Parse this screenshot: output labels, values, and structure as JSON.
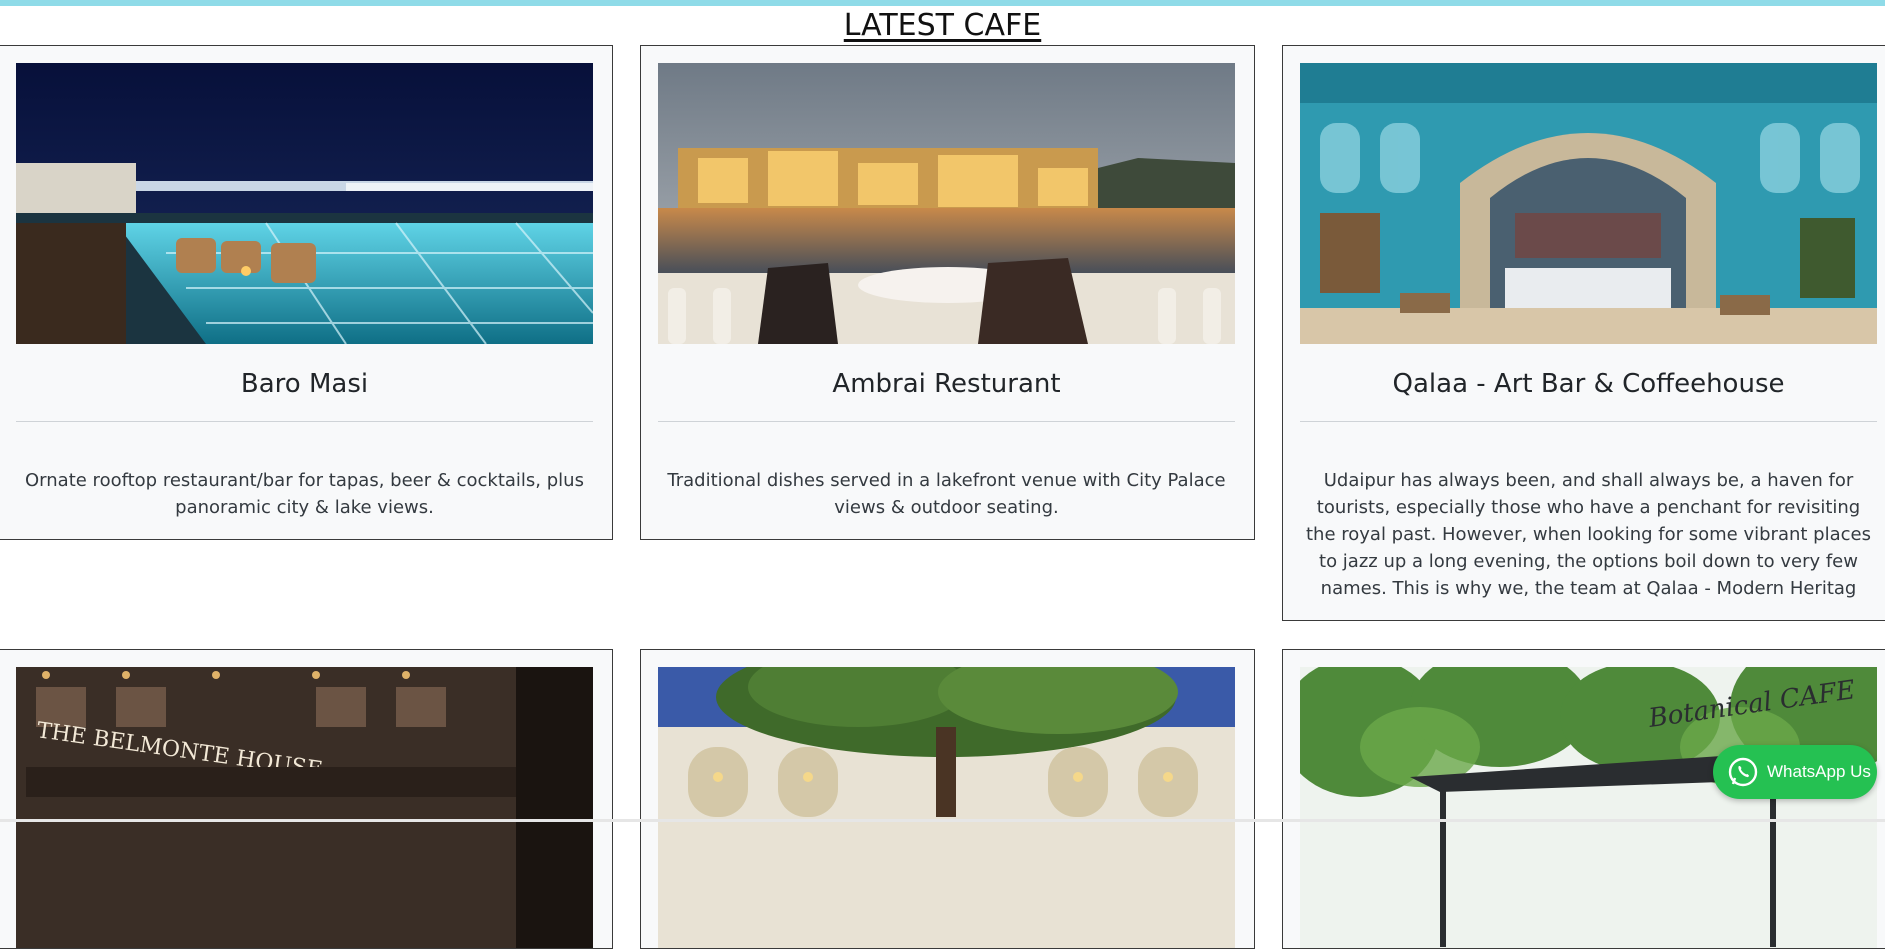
{
  "section": {
    "heading": "LATEST CAFE"
  },
  "cafes": [
    {
      "title": "Baro Masi",
      "description": "Ornate rooftop restaurant/bar for tapas, beer & cocktails, plus panoramic city & lake views.",
      "image": "rooftop-pool-night-photo"
    },
    {
      "title": "Ambrai Resturant",
      "description": "Traditional dishes served in a lakefront venue with City Palace views & outdoor seating.",
      "image": "lakefront-palace-dusk-photo"
    },
    {
      "title": "Qalaa - Art Bar & Coffeehouse",
      "description": "Udaipur has always been, and shall always be, a haven for tourists, especially those who have a penchant for revisiting the royal past. However, when looking for some vibrant places to jazz up a long evening, the options boil down to very few names. This is why we, the team at Qalaa - Modern Heritag",
      "image": "ornate-blue-arch-interior-photo"
    },
    {
      "title": "",
      "description": "",
      "image": "belmonte-house-facade-photo",
      "sign_text": "THE BELMONTE HOUSE"
    },
    {
      "title": "",
      "description": "",
      "image": "courtyard-tree-photo"
    },
    {
      "title": "",
      "description": "",
      "image": "botanical-cafe-garden-photo",
      "sign_text": "Botanical CAFE"
    }
  ],
  "whatsapp": {
    "label": "WhatsApp Us",
    "icon": "whatsapp-icon",
    "color": "#25c152"
  },
  "colors": {
    "topbar": "#8fdbe8",
    "card_bg": "#f8f9fa",
    "card_border": "#3a3a3a"
  }
}
